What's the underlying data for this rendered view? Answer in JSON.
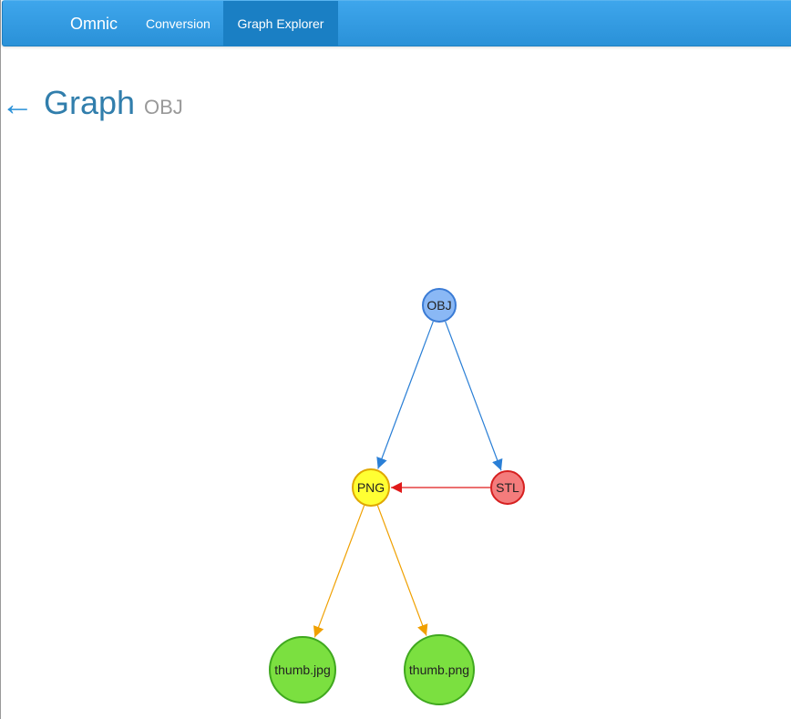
{
  "navbar": {
    "brand": "Omnic",
    "items": [
      {
        "label": "Conversion",
        "active": false
      },
      {
        "label": "Graph Explorer",
        "active": true
      }
    ]
  },
  "header": {
    "back_icon": "left-arrow-icon",
    "title": "Graph",
    "subtitle": "OBJ"
  },
  "graph": {
    "nodes": [
      {
        "id": "OBJ",
        "label": "OBJ",
        "fill": "#8ab8f5",
        "stroke": "#3a7bd5"
      },
      {
        "id": "PNG",
        "label": "PNG",
        "fill": "#ffff33",
        "stroke": "#e0a800"
      },
      {
        "id": "STL",
        "label": "STL",
        "fill": "#f47c7c",
        "stroke": "#d62020"
      },
      {
        "id": "thumb.jpg",
        "label": "thumb.jpg",
        "fill": "#7be040",
        "stroke": "#3fa81e"
      },
      {
        "id": "thumb.png",
        "label": "thumb.png",
        "fill": "#7be040",
        "stroke": "#3fa81e"
      }
    ],
    "edges": [
      {
        "from": "OBJ",
        "to": "PNG",
        "color": "#2a7fd6"
      },
      {
        "from": "OBJ",
        "to": "STL",
        "color": "#2a7fd6"
      },
      {
        "from": "STL",
        "to": "PNG",
        "color": "#e01a1a"
      },
      {
        "from": "PNG",
        "to": "thumb.jpg",
        "color": "#f0a000"
      },
      {
        "from": "PNG",
        "to": "thumb.png",
        "color": "#f0a000"
      }
    ]
  }
}
